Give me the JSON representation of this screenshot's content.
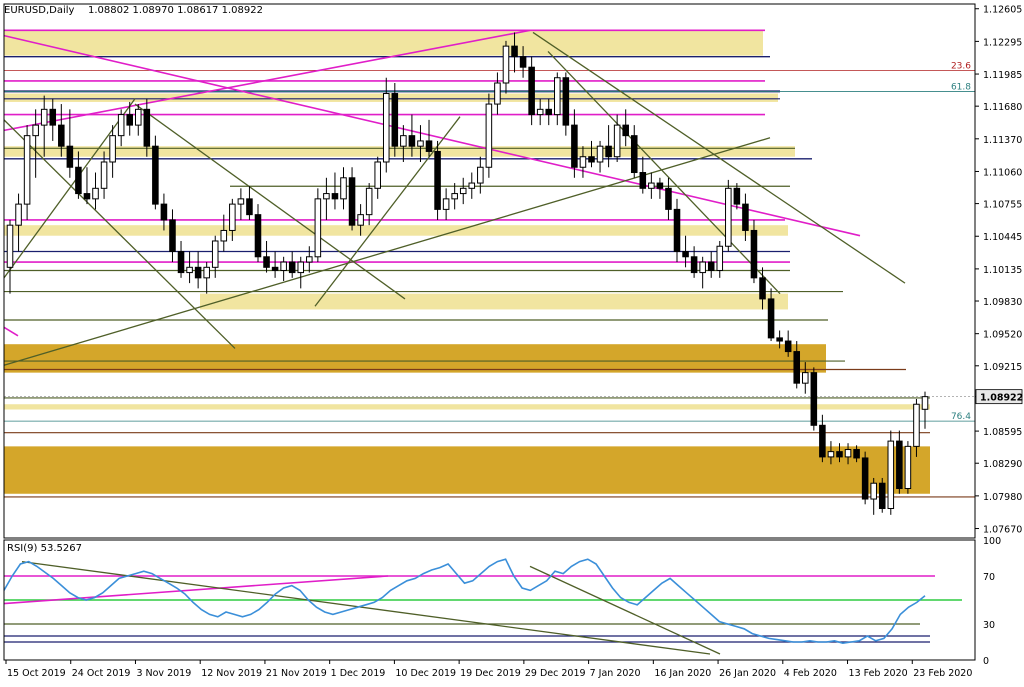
{
  "header": {
    "symbol_label": "EURUSD,Daily",
    "ohlc": "1.08802 1.08970 1.08617 1.08922"
  },
  "rsi_header": {
    "label": "RSI(9) 53.5267"
  },
  "colors": {
    "background": "#ffffff",
    "bull_candle": "#ffffff",
    "bear_candle": "#000000",
    "rsi_line": "#3b8fd9",
    "zone_light": "#f1e5a0",
    "zone_dark": "#d4a62a",
    "magenta": "#e01ec8",
    "navy": "#1a1f6e",
    "olive": "#4f5f28",
    "brown": "#7a3b1a",
    "green_level": "#2ecc40",
    "fib_teal": "#2c7f7f",
    "fib_red": "#b02020"
  },
  "chart_data": [
    {
      "type": "candlestick",
      "title": "EURUSD,Daily",
      "x_tick_labels": [
        "15 Oct 2019",
        "24 Oct 2019",
        "3 Nov 2019",
        "12 Nov 2019",
        "21 Nov 2019",
        "1 Dec 2019",
        "10 Dec 2019",
        "19 Dec 2019",
        "29 Dec 2019",
        "7 Jan 2020",
        "16 Jan 2020",
        "26 Jan 2020",
        "4 Feb 2020",
        "13 Feb 2020",
        "23 Feb 2020"
      ],
      "y_tick_labels": [
        "1.12605",
        "1.12295",
        "1.11985",
        "1.11680",
        "1.11370",
        "1.11060",
        "1.10755",
        "1.10445",
        "1.10135",
        "1.09830",
        "1.09520",
        "1.09215",
        "1.08922",
        "1.08595",
        "1.08290",
        "1.07980",
        "1.07670"
      ],
      "ylim": [
        1.0758,
        1.1265
      ],
      "current_price": 1.08922,
      "fib_labels": [
        {
          "text": "23.6",
          "price": 1.1202
        },
        {
          "text": "61.8",
          "price": 1.1182
        },
        {
          "text": "76.4",
          "price": 1.0869
        }
      ],
      "ohlc": [
        {
          "o": 1.1015,
          "h": 1.106,
          "l": 1.099,
          "c": 1.1055
        },
        {
          "o": 1.1055,
          "h": 1.1085,
          "l": 1.103,
          "c": 1.1075
        },
        {
          "o": 1.1075,
          "h": 1.115,
          "l": 1.106,
          "c": 1.114
        },
        {
          "o": 1.114,
          "h": 1.1165,
          "l": 1.11,
          "c": 1.115
        },
        {
          "o": 1.115,
          "h": 1.1178,
          "l": 1.112,
          "c": 1.1165
        },
        {
          "o": 1.1165,
          "h": 1.1175,
          "l": 1.1135,
          "c": 1.115
        },
        {
          "o": 1.115,
          "h": 1.117,
          "l": 1.112,
          "c": 1.113
        },
        {
          "o": 1.113,
          "h": 1.1165,
          "l": 1.11,
          "c": 1.111
        },
        {
          "o": 1.111,
          "h": 1.1125,
          "l": 1.108,
          "c": 1.1085
        },
        {
          "o": 1.1085,
          "h": 1.111,
          "l": 1.1075,
          "c": 1.108
        },
        {
          "o": 1.108,
          "h": 1.1105,
          "l": 1.107,
          "c": 1.109
        },
        {
          "o": 1.109,
          "h": 1.1125,
          "l": 1.108,
          "c": 1.1115
        },
        {
          "o": 1.1115,
          "h": 1.115,
          "l": 1.11,
          "c": 1.114
        },
        {
          "o": 1.114,
          "h": 1.1165,
          "l": 1.113,
          "c": 1.116
        },
        {
          "o": 1.116,
          "h": 1.1172,
          "l": 1.114,
          "c": 1.115
        },
        {
          "o": 1.115,
          "h": 1.117,
          "l": 1.114,
          "c": 1.1165
        },
        {
          "o": 1.1165,
          "h": 1.1175,
          "l": 1.112,
          "c": 1.113
        },
        {
          "o": 1.113,
          "h": 1.114,
          "l": 1.107,
          "c": 1.1075
        },
        {
          "o": 1.1075,
          "h": 1.1085,
          "l": 1.105,
          "c": 1.106
        },
        {
          "o": 1.106,
          "h": 1.107,
          "l": 1.102,
          "c": 1.103
        },
        {
          "o": 1.103,
          "h": 1.104,
          "l": 1.1005,
          "c": 1.101
        },
        {
          "o": 1.101,
          "h": 1.103,
          "l": 1.1,
          "c": 1.1015
        },
        {
          "o": 1.1015,
          "h": 1.103,
          "l": 1.0995,
          "c": 1.1005
        },
        {
          "o": 1.1005,
          "h": 1.102,
          "l": 1.099,
          "c": 1.1015
        },
        {
          "o": 1.1015,
          "h": 1.1045,
          "l": 1.1005,
          "c": 1.104
        },
        {
          "o": 1.104,
          "h": 1.1065,
          "l": 1.103,
          "c": 1.105
        },
        {
          "o": 1.105,
          "h": 1.108,
          "l": 1.104,
          "c": 1.1075
        },
        {
          "o": 1.1075,
          "h": 1.109,
          "l": 1.106,
          "c": 1.108
        },
        {
          "o": 1.108,
          "h": 1.1092,
          "l": 1.106,
          "c": 1.1065
        },
        {
          "o": 1.1065,
          "h": 1.1075,
          "l": 1.102,
          "c": 1.1025
        },
        {
          "o": 1.1025,
          "h": 1.104,
          "l": 1.101,
          "c": 1.1015
        },
        {
          "o": 1.1015,
          "h": 1.103,
          "l": 1.1005,
          "c": 1.1012
        },
        {
          "o": 1.1012,
          "h": 1.1025,
          "l": 1.1002,
          "c": 1.102
        },
        {
          "o": 1.102,
          "h": 1.103,
          "l": 1.1005,
          "c": 1.101
        },
        {
          "o": 1.101,
          "h": 1.1025,
          "l": 1.0995,
          "c": 1.102
        },
        {
          "o": 1.102,
          "h": 1.1035,
          "l": 1.101,
          "c": 1.1025
        },
        {
          "o": 1.1025,
          "h": 1.109,
          "l": 1.102,
          "c": 1.108
        },
        {
          "o": 1.108,
          "h": 1.11,
          "l": 1.106,
          "c": 1.1085
        },
        {
          "o": 1.1085,
          "h": 1.1105,
          "l": 1.107,
          "c": 1.108
        },
        {
          "o": 1.108,
          "h": 1.111,
          "l": 1.107,
          "c": 1.11
        },
        {
          "o": 1.11,
          "h": 1.111,
          "l": 1.105,
          "c": 1.1055
        },
        {
          "o": 1.1055,
          "h": 1.1075,
          "l": 1.1045,
          "c": 1.1065
        },
        {
          "o": 1.1065,
          "h": 1.1095,
          "l": 1.1055,
          "c": 1.109
        },
        {
          "o": 1.109,
          "h": 1.112,
          "l": 1.108,
          "c": 1.1115
        },
        {
          "o": 1.1115,
          "h": 1.1195,
          "l": 1.1105,
          "c": 1.118
        },
        {
          "o": 1.118,
          "h": 1.119,
          "l": 1.112,
          "c": 1.113
        },
        {
          "o": 1.113,
          "h": 1.115,
          "l": 1.1115,
          "c": 1.114
        },
        {
          "o": 1.114,
          "h": 1.116,
          "l": 1.112,
          "c": 1.113
        },
        {
          "o": 1.113,
          "h": 1.115,
          "l": 1.1115,
          "c": 1.1135
        },
        {
          "o": 1.1135,
          "h": 1.1155,
          "l": 1.112,
          "c": 1.1125
        },
        {
          "o": 1.1125,
          "h": 1.1135,
          "l": 1.106,
          "c": 1.107
        },
        {
          "o": 1.107,
          "h": 1.109,
          "l": 1.106,
          "c": 1.108
        },
        {
          "o": 1.108,
          "h": 1.1095,
          "l": 1.107,
          "c": 1.1085
        },
        {
          "o": 1.1085,
          "h": 1.11,
          "l": 1.1075,
          "c": 1.109
        },
        {
          "o": 1.109,
          "h": 1.1105,
          "l": 1.108,
          "c": 1.1095
        },
        {
          "o": 1.1095,
          "h": 1.112,
          "l": 1.1085,
          "c": 1.111
        },
        {
          "o": 1.111,
          "h": 1.118,
          "l": 1.11,
          "c": 1.117
        },
        {
          "o": 1.117,
          "h": 1.12,
          "l": 1.116,
          "c": 1.119
        },
        {
          "o": 1.119,
          "h": 1.123,
          "l": 1.118,
          "c": 1.1225
        },
        {
          "o": 1.1225,
          "h": 1.1238,
          "l": 1.12,
          "c": 1.1215
        },
        {
          "o": 1.1215,
          "h": 1.1225,
          "l": 1.1195,
          "c": 1.1205
        },
        {
          "o": 1.1205,
          "h": 1.1215,
          "l": 1.115,
          "c": 1.116
        },
        {
          "o": 1.116,
          "h": 1.1175,
          "l": 1.115,
          "c": 1.1165
        },
        {
          "o": 1.1165,
          "h": 1.1175,
          "l": 1.115,
          "c": 1.116
        },
        {
          "o": 1.116,
          "h": 1.12,
          "l": 1.115,
          "c": 1.1195
        },
        {
          "o": 1.1195,
          "h": 1.12,
          "l": 1.114,
          "c": 1.115
        },
        {
          "o": 1.115,
          "h": 1.1165,
          "l": 1.11,
          "c": 1.111
        },
        {
          "o": 1.111,
          "h": 1.113,
          "l": 1.11,
          "c": 1.112
        },
        {
          "o": 1.112,
          "h": 1.1135,
          "l": 1.111,
          "c": 1.1115
        },
        {
          "o": 1.1115,
          "h": 1.1135,
          "l": 1.1105,
          "c": 1.113
        },
        {
          "o": 1.113,
          "h": 1.115,
          "l": 1.111,
          "c": 1.112
        },
        {
          "o": 1.112,
          "h": 1.116,
          "l": 1.1115,
          "c": 1.115
        },
        {
          "o": 1.115,
          "h": 1.1165,
          "l": 1.113,
          "c": 1.114
        },
        {
          "o": 1.114,
          "h": 1.115,
          "l": 1.11,
          "c": 1.1105
        },
        {
          "o": 1.1105,
          "h": 1.112,
          "l": 1.1085,
          "c": 1.109
        },
        {
          "o": 1.109,
          "h": 1.1105,
          "l": 1.108,
          "c": 1.1095
        },
        {
          "o": 1.1095,
          "h": 1.11,
          "l": 1.108,
          "c": 1.109
        },
        {
          "o": 1.109,
          "h": 1.11,
          "l": 1.106,
          "c": 1.107
        },
        {
          "o": 1.107,
          "h": 1.108,
          "l": 1.102,
          "c": 1.103
        },
        {
          "o": 1.103,
          "h": 1.1045,
          "l": 1.1015,
          "c": 1.1025
        },
        {
          "o": 1.1025,
          "h": 1.1035,
          "l": 1.1005,
          "c": 1.101
        },
        {
          "o": 1.101,
          "h": 1.1025,
          "l": 1.0995,
          "c": 1.102
        },
        {
          "o": 1.102,
          "h": 1.103,
          "l": 1.1005,
          "c": 1.1012
        },
        {
          "o": 1.1012,
          "h": 1.104,
          "l": 1.1005,
          "c": 1.1035
        },
        {
          "o": 1.1035,
          "h": 1.1098,
          "l": 1.103,
          "c": 1.109
        },
        {
          "o": 1.109,
          "h": 1.1095,
          "l": 1.107,
          "c": 1.1075
        },
        {
          "o": 1.1075,
          "h": 1.1085,
          "l": 1.104,
          "c": 1.105
        },
        {
          "o": 1.105,
          "h": 1.106,
          "l": 1.1,
          "c": 1.1005
        },
        {
          "o": 1.1005,
          "h": 1.1015,
          "l": 1.0975,
          "c": 1.0985
        },
        {
          "o": 1.0985,
          "h": 1.0995,
          "l": 1.0945,
          "c": 1.0948
        },
        {
          "o": 1.0948,
          "h": 1.0955,
          "l": 1.0938,
          "c": 1.0945
        },
        {
          "o": 1.0945,
          "h": 1.0955,
          "l": 1.093,
          "c": 1.0935
        },
        {
          "o": 1.0935,
          "h": 1.0945,
          "l": 1.09,
          "c": 1.0905
        },
        {
          "o": 1.0905,
          "h": 1.0925,
          "l": 1.0895,
          "c": 1.0915
        },
        {
          "o": 1.0915,
          "h": 1.092,
          "l": 1.086,
          "c": 1.0865
        },
        {
          "o": 1.0865,
          "h": 1.0875,
          "l": 1.083,
          "c": 1.0835
        },
        {
          "o": 1.0835,
          "h": 1.085,
          "l": 1.0828,
          "c": 1.084
        },
        {
          "o": 1.084,
          "h": 1.0848,
          "l": 1.083,
          "c": 1.0835
        },
        {
          "o": 1.0835,
          "h": 1.0848,
          "l": 1.0828,
          "c": 1.0842
        },
        {
          "o": 1.0842,
          "h": 1.0846,
          "l": 1.083,
          "c": 1.0834
        },
        {
          "o": 1.0834,
          "h": 1.084,
          "l": 1.079,
          "c": 1.0795
        },
        {
          "o": 1.0795,
          "h": 1.0815,
          "l": 1.078,
          "c": 1.081
        },
        {
          "o": 1.081,
          "h": 1.0815,
          "l": 1.0782,
          "c": 1.0786
        },
        {
          "o": 1.0786,
          "h": 1.086,
          "l": 1.078,
          "c": 1.085
        },
        {
          "o": 1.085,
          "h": 1.086,
          "l": 1.08,
          "c": 1.0805
        },
        {
          "o": 1.0805,
          "h": 1.085,
          "l": 1.08,
          "c": 1.0845
        },
        {
          "o": 1.0845,
          "h": 1.089,
          "l": 1.0835,
          "c": 1.0885
        },
        {
          "o": 1.08802,
          "h": 1.0897,
          "l": 1.08617,
          "c": 1.08922
        }
      ]
    },
    {
      "type": "line",
      "title": "RSI(9) 53.5267",
      "ylim": [
        0,
        100
      ],
      "y_tick_labels": [
        "100",
        "70",
        "30",
        "0"
      ],
      "levels": [
        70,
        50,
        30,
        20,
        15
      ],
      "series": [
        {
          "values": [
            58,
            70,
            80,
            82,
            78,
            73,
            68,
            62,
            56,
            52,
            50,
            52,
            56,
            62,
            68,
            70,
            72,
            74,
            72,
            68,
            64,
            60,
            55,
            48,
            42,
            38,
            36,
            40,
            38,
            36,
            38,
            42,
            48,
            55,
            60,
            62,
            58,
            50,
            44,
            40,
            38,
            40,
            42,
            44,
            46,
            48,
            52,
            58,
            62,
            66,
            68,
            72,
            75,
            77,
            80,
            72,
            64,
            66,
            72,
            78,
            82,
            84,
            70,
            60,
            58,
            62,
            66,
            74,
            72,
            78,
            82,
            84,
            80,
            70,
            60,
            52,
            48,
            46,
            52,
            58,
            64,
            68,
            62,
            56,
            50,
            44,
            38,
            32,
            30,
            28,
            26,
            22,
            20,
            18,
            17,
            16,
            15,
            15,
            16,
            15,
            15,
            16,
            14,
            15,
            16,
            20,
            16,
            18,
            26,
            38,
            44,
            48,
            53.5
          ]
        }
      ]
    }
  ]
}
